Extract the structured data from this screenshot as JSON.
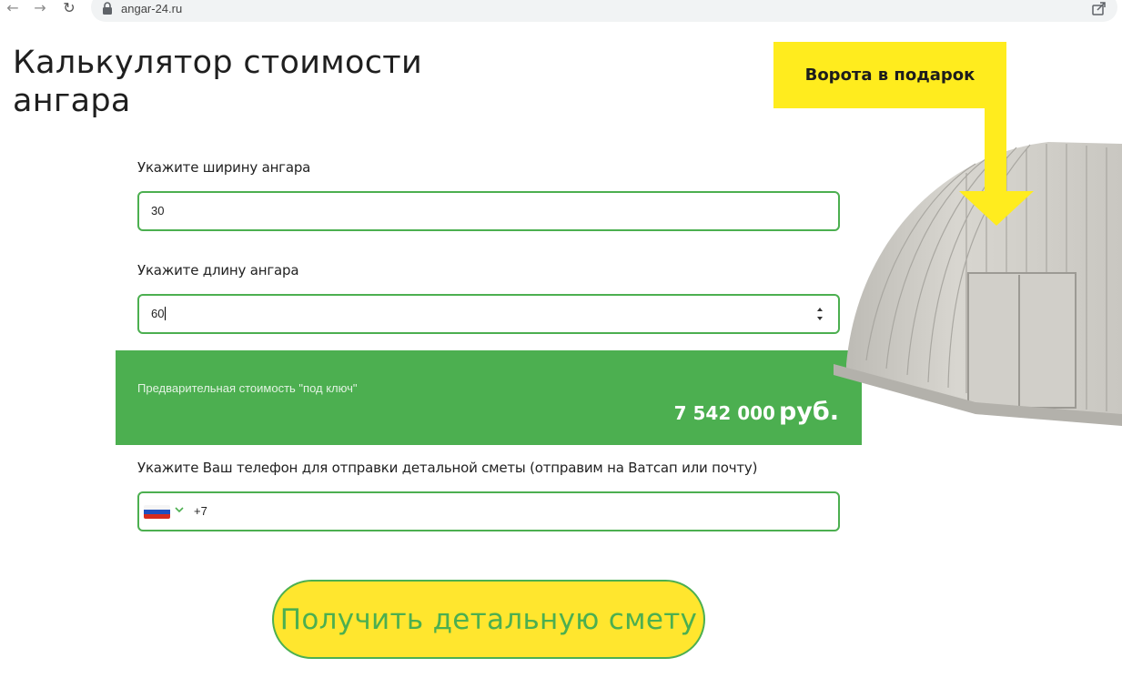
{
  "browser": {
    "url": "angar-24.ru",
    "back_icon": "arrow-left-icon",
    "forward_icon": "arrow-right-icon",
    "reload_icon": "reload-icon",
    "lock_icon": "lock-icon",
    "share_icon": "share-icon"
  },
  "page": {
    "title": "Калькулятор стоимости ангара"
  },
  "form": {
    "width_label": "Укажите ширину ангара",
    "width_value": "30",
    "length_label": "Укажите длину ангара",
    "length_value": "60",
    "price_label": "Предварительная стоимость \"под ключ\"",
    "price_amount": "7 542 000",
    "price_currency": "руб.",
    "phone_label": "Укажите Ваш телефон для отправки детальной сметы (отправим на Ватсап или почту)",
    "phone_prefix": "+7",
    "country_flag": "russia-flag-icon",
    "submit_label": "Получить детальную смету"
  },
  "promo": {
    "badge_text": "Ворота в подарок"
  },
  "colors": {
    "accent_green": "#4caf50",
    "button_yellow": "#ffe62e",
    "badge_yellow": "#ffec1e"
  }
}
